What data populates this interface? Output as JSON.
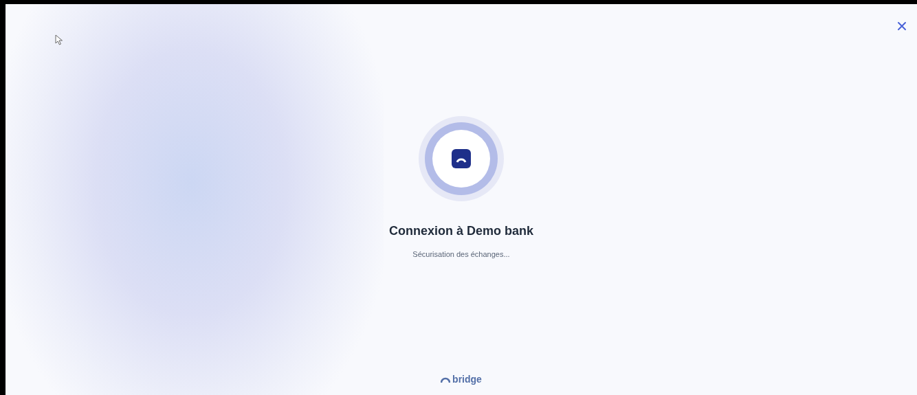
{
  "title": "Connexion à Demo bank",
  "status": "Sécurisation des échanges...",
  "footer": {
    "brand": "bridge"
  }
}
